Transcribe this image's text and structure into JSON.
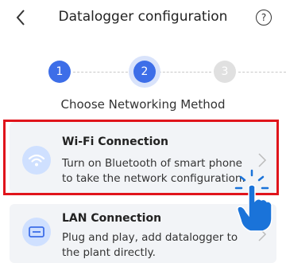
{
  "header": {
    "title": "Datalogger configuration",
    "back_icon": "chevron-left-icon",
    "help_label": "?"
  },
  "stepper": {
    "steps": [
      "1",
      "2",
      "3"
    ],
    "current": 2
  },
  "subtitle": "Choose Networking Method",
  "options": [
    {
      "title": "Wi-Fi Connection",
      "description": "Turn on Bluetooth of smart phone to take the network configuration.",
      "icon": "wifi-icon",
      "highlighted": true
    },
    {
      "title": "LAN Connection",
      "description": "Plug and play, add datalogger to the plant directly.",
      "icon": "lan-icon",
      "highlighted": false
    }
  ],
  "colors": {
    "accent": "#3d6ee8",
    "highlight_border": "#e0141b",
    "card_bg": "#f2f4f7",
    "icon_bg": "#cfe0ff"
  }
}
